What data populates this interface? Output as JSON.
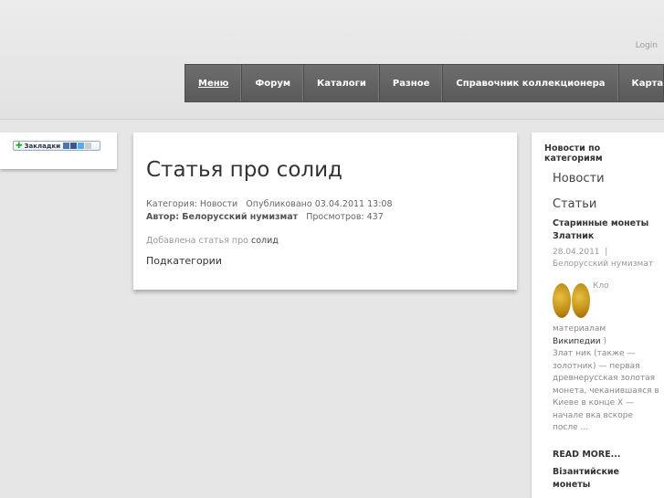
{
  "header": {
    "login_label": "Login"
  },
  "nav": {
    "items": [
      {
        "label": "Меню"
      },
      {
        "label": "Форум"
      },
      {
        "label": "Каталоги"
      },
      {
        "label": "Разное"
      },
      {
        "label": "Справочник коллекционера"
      },
      {
        "label": "Карта сайта"
      }
    ]
  },
  "bookmarks": {
    "label": "Закладки"
  },
  "article": {
    "title": "Статья про солид",
    "category_label": "Категория:",
    "category_value": "Новости",
    "published": "Опубликовано 03.04.2011 13:08",
    "author": "Автор: Белорусский нумизмат",
    "views": "Просмотров: 437",
    "added_prefix": "Добавлена статья про",
    "added_link": "солид",
    "subcategories": "Подкатегории"
  },
  "sidebar": {
    "heading": "Новости по категориям",
    "news": "Новости",
    "articles": "Статьи",
    "item1_title": "Старинные монеты Златник",
    "item1_date": "28.04.2011",
    "item1_author": "Белорусский нумизмат",
    "item1_kno": "Кло",
    "item1_materials": "материалам",
    "item1_wiki": "Википедии",
    "item1_paren": ")",
    "item1_text": "Злат ник (также — золотник) — первая древнерусская золотая монета, чеканившаяся в Киеве в конце X — начале",
    "item1_text2": "вка",
    "item1_text3": "вскоре после ...",
    "read_more": "READ MORE...",
    "item2_title": "Візантийские монеты"
  }
}
